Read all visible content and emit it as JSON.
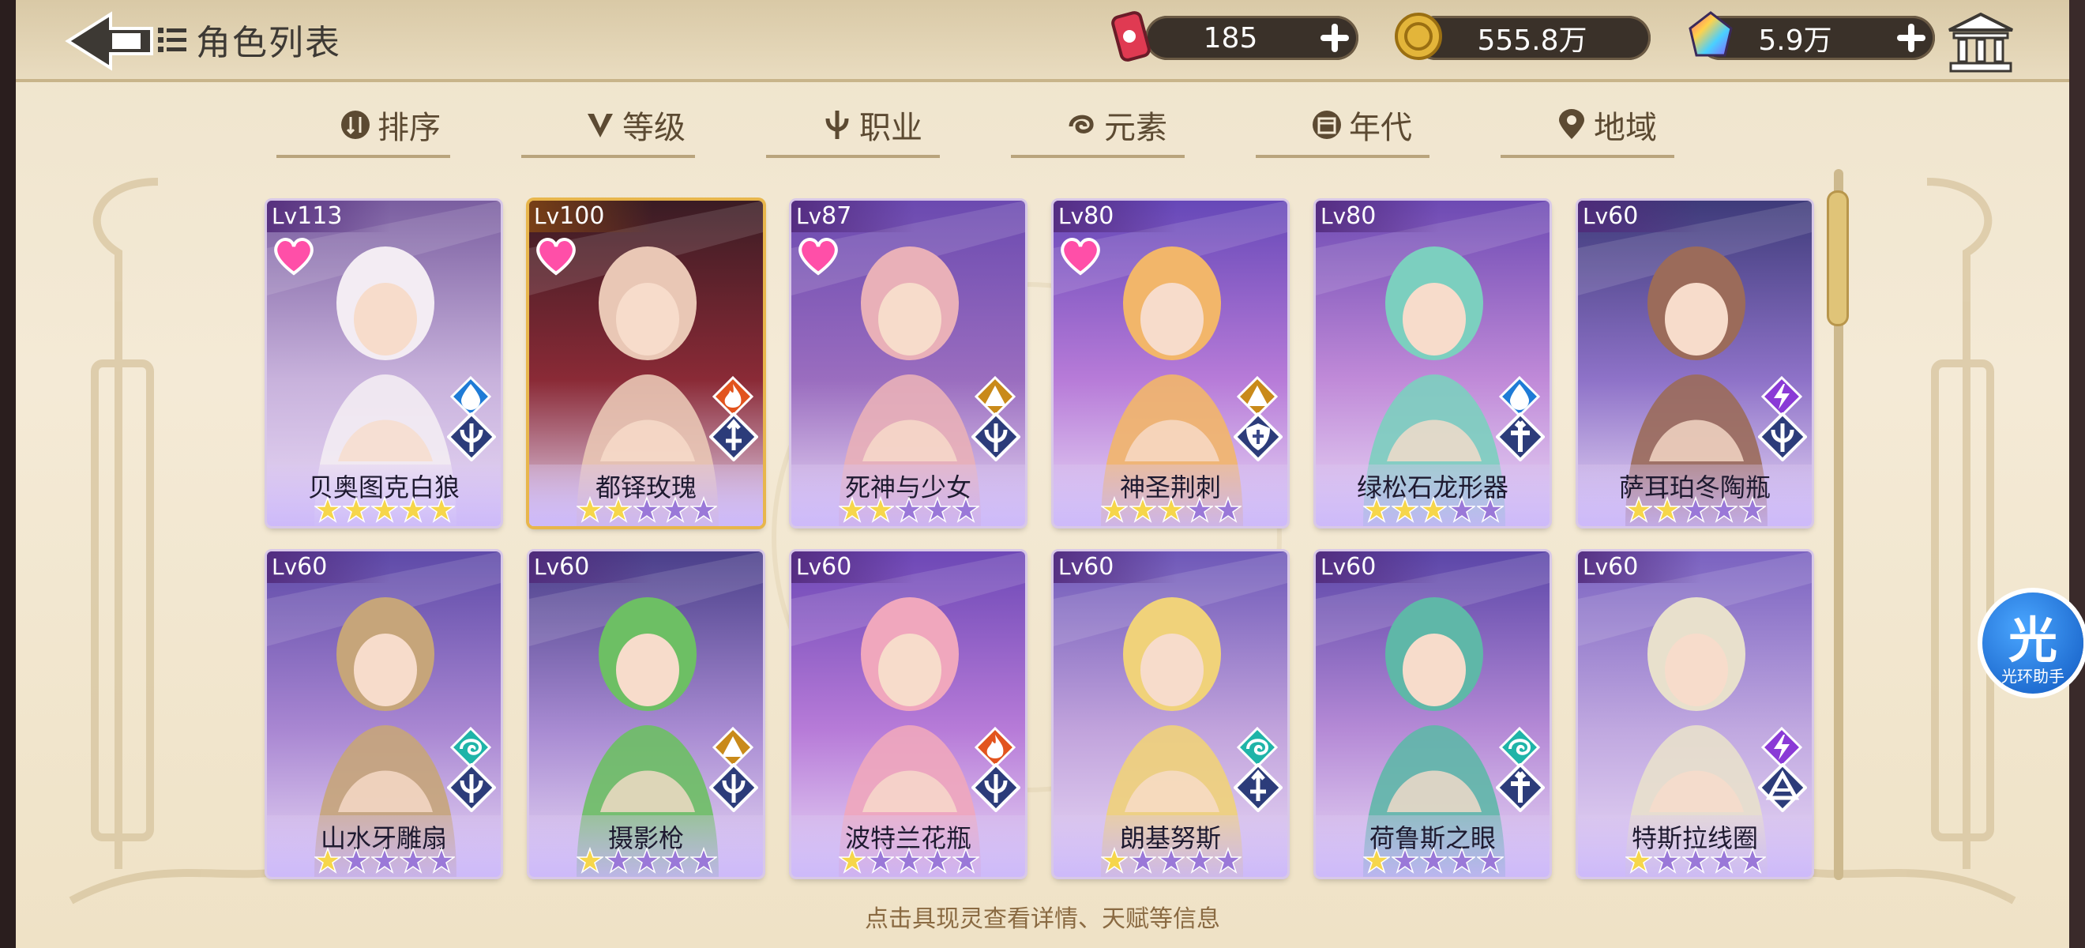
{
  "header": {
    "title": "角色列表",
    "resources": [
      {
        "name": "stamina",
        "icon": "energy-can-icon",
        "value": "185"
      },
      {
        "name": "gold",
        "icon": "gold-coin-icon",
        "value": "555.8万"
      },
      {
        "name": "gems",
        "icon": "rainbow-gem-icon",
        "value": "5.9万"
      }
    ]
  },
  "filters": [
    {
      "label": "排序",
      "icon": "sort-icon"
    },
    {
      "label": "等级",
      "icon": "level-v-icon"
    },
    {
      "label": "职业",
      "icon": "job-icon"
    },
    {
      "label": "元素",
      "icon": "element-swirl-icon"
    },
    {
      "label": "年代",
      "icon": "calendar-icon"
    },
    {
      "label": "地域",
      "icon": "location-pin-icon"
    }
  ],
  "characters": [
    {
      "level": "113",
      "name": "贝奥图克白狼",
      "stars": 5,
      "favorite": true,
      "element": "water",
      "job": "trident",
      "palette": [
        "#f3ecf3",
        "#c8b2dc",
        "#7a5ea0"
      ],
      "frame": "normal"
    },
    {
      "level": "100",
      "name": "都铎玫瑰",
      "stars": 2,
      "favorite": true,
      "element": "fire",
      "job": "sword",
      "palette": [
        "#e9c7b5",
        "#8a2a36",
        "#3a1c24"
      ],
      "frame": "gold"
    },
    {
      "level": "87",
      "name": "死神与少女",
      "stars": 2,
      "favorite": true,
      "element": "earth",
      "job": "trident",
      "palette": [
        "#e9b0b8",
        "#9a6dbf",
        "#6b4ab0"
      ],
      "frame": "normal"
    },
    {
      "level": "80",
      "name": "神圣荆刺",
      "stars": 3,
      "favorite": true,
      "element": "earth",
      "job": "shield",
      "palette": [
        "#f2b66a",
        "#b77bd8",
        "#6648b8"
      ],
      "frame": "normal"
    },
    {
      "level": "80",
      "name": "绿松石龙形器",
      "stars": 3,
      "favorite": false,
      "element": "water",
      "job": "cross",
      "palette": [
        "#7ccfbf",
        "#c08ad8",
        "#6d4ab3"
      ],
      "frame": "normal"
    },
    {
      "level": "60",
      "name": "萨耳珀冬陶瓶",
      "stars": 2,
      "favorite": false,
      "element": "thunder",
      "job": "trident",
      "palette": [
        "#9b6b5a",
        "#8e72c8",
        "#3e3b7a"
      ],
      "frame": "normal"
    },
    {
      "level": "60",
      "name": "山水牙雕扇",
      "stars": 1,
      "favorite": false,
      "element": "wind",
      "job": "trident",
      "palette": [
        "#c6a57a",
        "#a987d2",
        "#5e4aa8"
      ],
      "frame": "normal"
    },
    {
      "level": "60",
      "name": "摄影枪",
      "stars": 1,
      "favorite": false,
      "element": "earth",
      "job": "trident",
      "palette": [
        "#6dbf64",
        "#a88bd2",
        "#4a3f8a"
      ],
      "frame": "normal"
    },
    {
      "level": "60",
      "name": "波特兰花瓶",
      "stars": 1,
      "favorite": false,
      "element": "fire",
      "job": "trident",
      "palette": [
        "#f0a7bd",
        "#b77bd8",
        "#6d48b6"
      ],
      "frame": "normal"
    },
    {
      "level": "60",
      "name": "朗基努斯",
      "stars": 1,
      "favorite": false,
      "element": "wind",
      "job": "sword",
      "palette": [
        "#f0d27a",
        "#c1a3dc",
        "#6e58b8"
      ],
      "frame": "normal"
    },
    {
      "level": "60",
      "name": "荷鲁斯之眼",
      "stars": 1,
      "favorite": false,
      "element": "wind",
      "job": "cross",
      "palette": [
        "#5fb7a8",
        "#b58ad6",
        "#5b46a8"
      ],
      "frame": "normal"
    },
    {
      "level": "60",
      "name": "特斯拉线圈",
      "stars": 1,
      "favorite": false,
      "element": "thunder",
      "job": "pyramid",
      "palette": [
        "#e8e0cc",
        "#c0a8e0",
        "#7a62c0"
      ],
      "frame": "normal"
    }
  ],
  "footer": {
    "hint": "点击具现灵查看详情、天赋等信息"
  },
  "helper": {
    "glyph": "光",
    "label": "光环助手"
  },
  "colors": {
    "accent": "#3a3129",
    "text": "#5c4a32",
    "star_gold": "#f6d64a",
    "star_empty": "#9a78d8"
  }
}
